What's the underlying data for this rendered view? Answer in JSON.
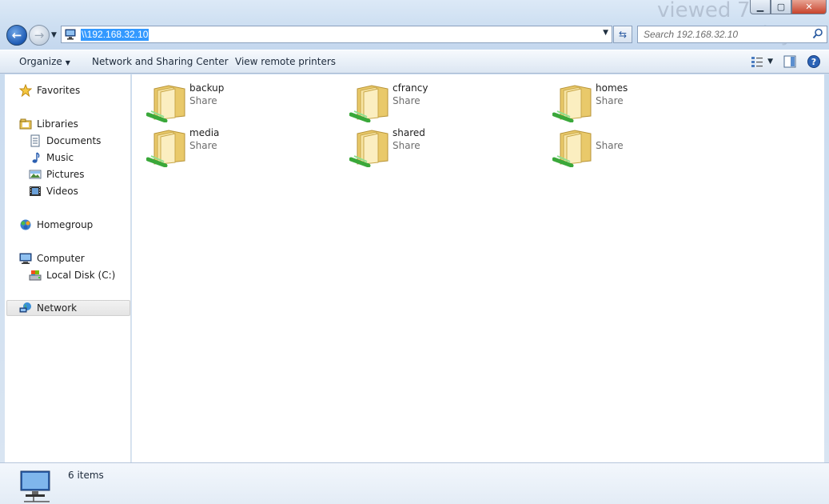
{
  "window": {
    "ghost_text": [
      "viewed",
      "7",
      "today"
    ],
    "controls": [
      "minimize",
      "maximize",
      "close"
    ]
  },
  "navigation": {
    "address": "\\\\192.168.32.10",
    "search_placeholder": "Search 192.168.32.10"
  },
  "toolbar": {
    "organize": "Organize",
    "network_sharing": "Network and Sharing Center",
    "view_printers": "View remote printers"
  },
  "sidebar": {
    "favorites": "Favorites",
    "libraries": "Libraries",
    "documents": "Documents",
    "music": "Music",
    "pictures": "Pictures",
    "videos": "Videos",
    "homegroup": "Homegroup",
    "computer": "Computer",
    "local_disk": "Local Disk (C:)",
    "network": "Network"
  },
  "shares": [
    {
      "name": "backup",
      "type": "Share"
    },
    {
      "name": "cfrancy",
      "type": "Share"
    },
    {
      "name": "homes",
      "type": "Share"
    },
    {
      "name": "media",
      "type": "Share"
    },
    {
      "name": "shared",
      "type": "Share"
    },
    {
      "name": "",
      "type": "Share"
    }
  ],
  "status": {
    "count": "6 items"
  },
  "colors": {
    "selection": "#3399ff",
    "folder": "#f2d77e",
    "share_arrow": "#3aa83a"
  }
}
